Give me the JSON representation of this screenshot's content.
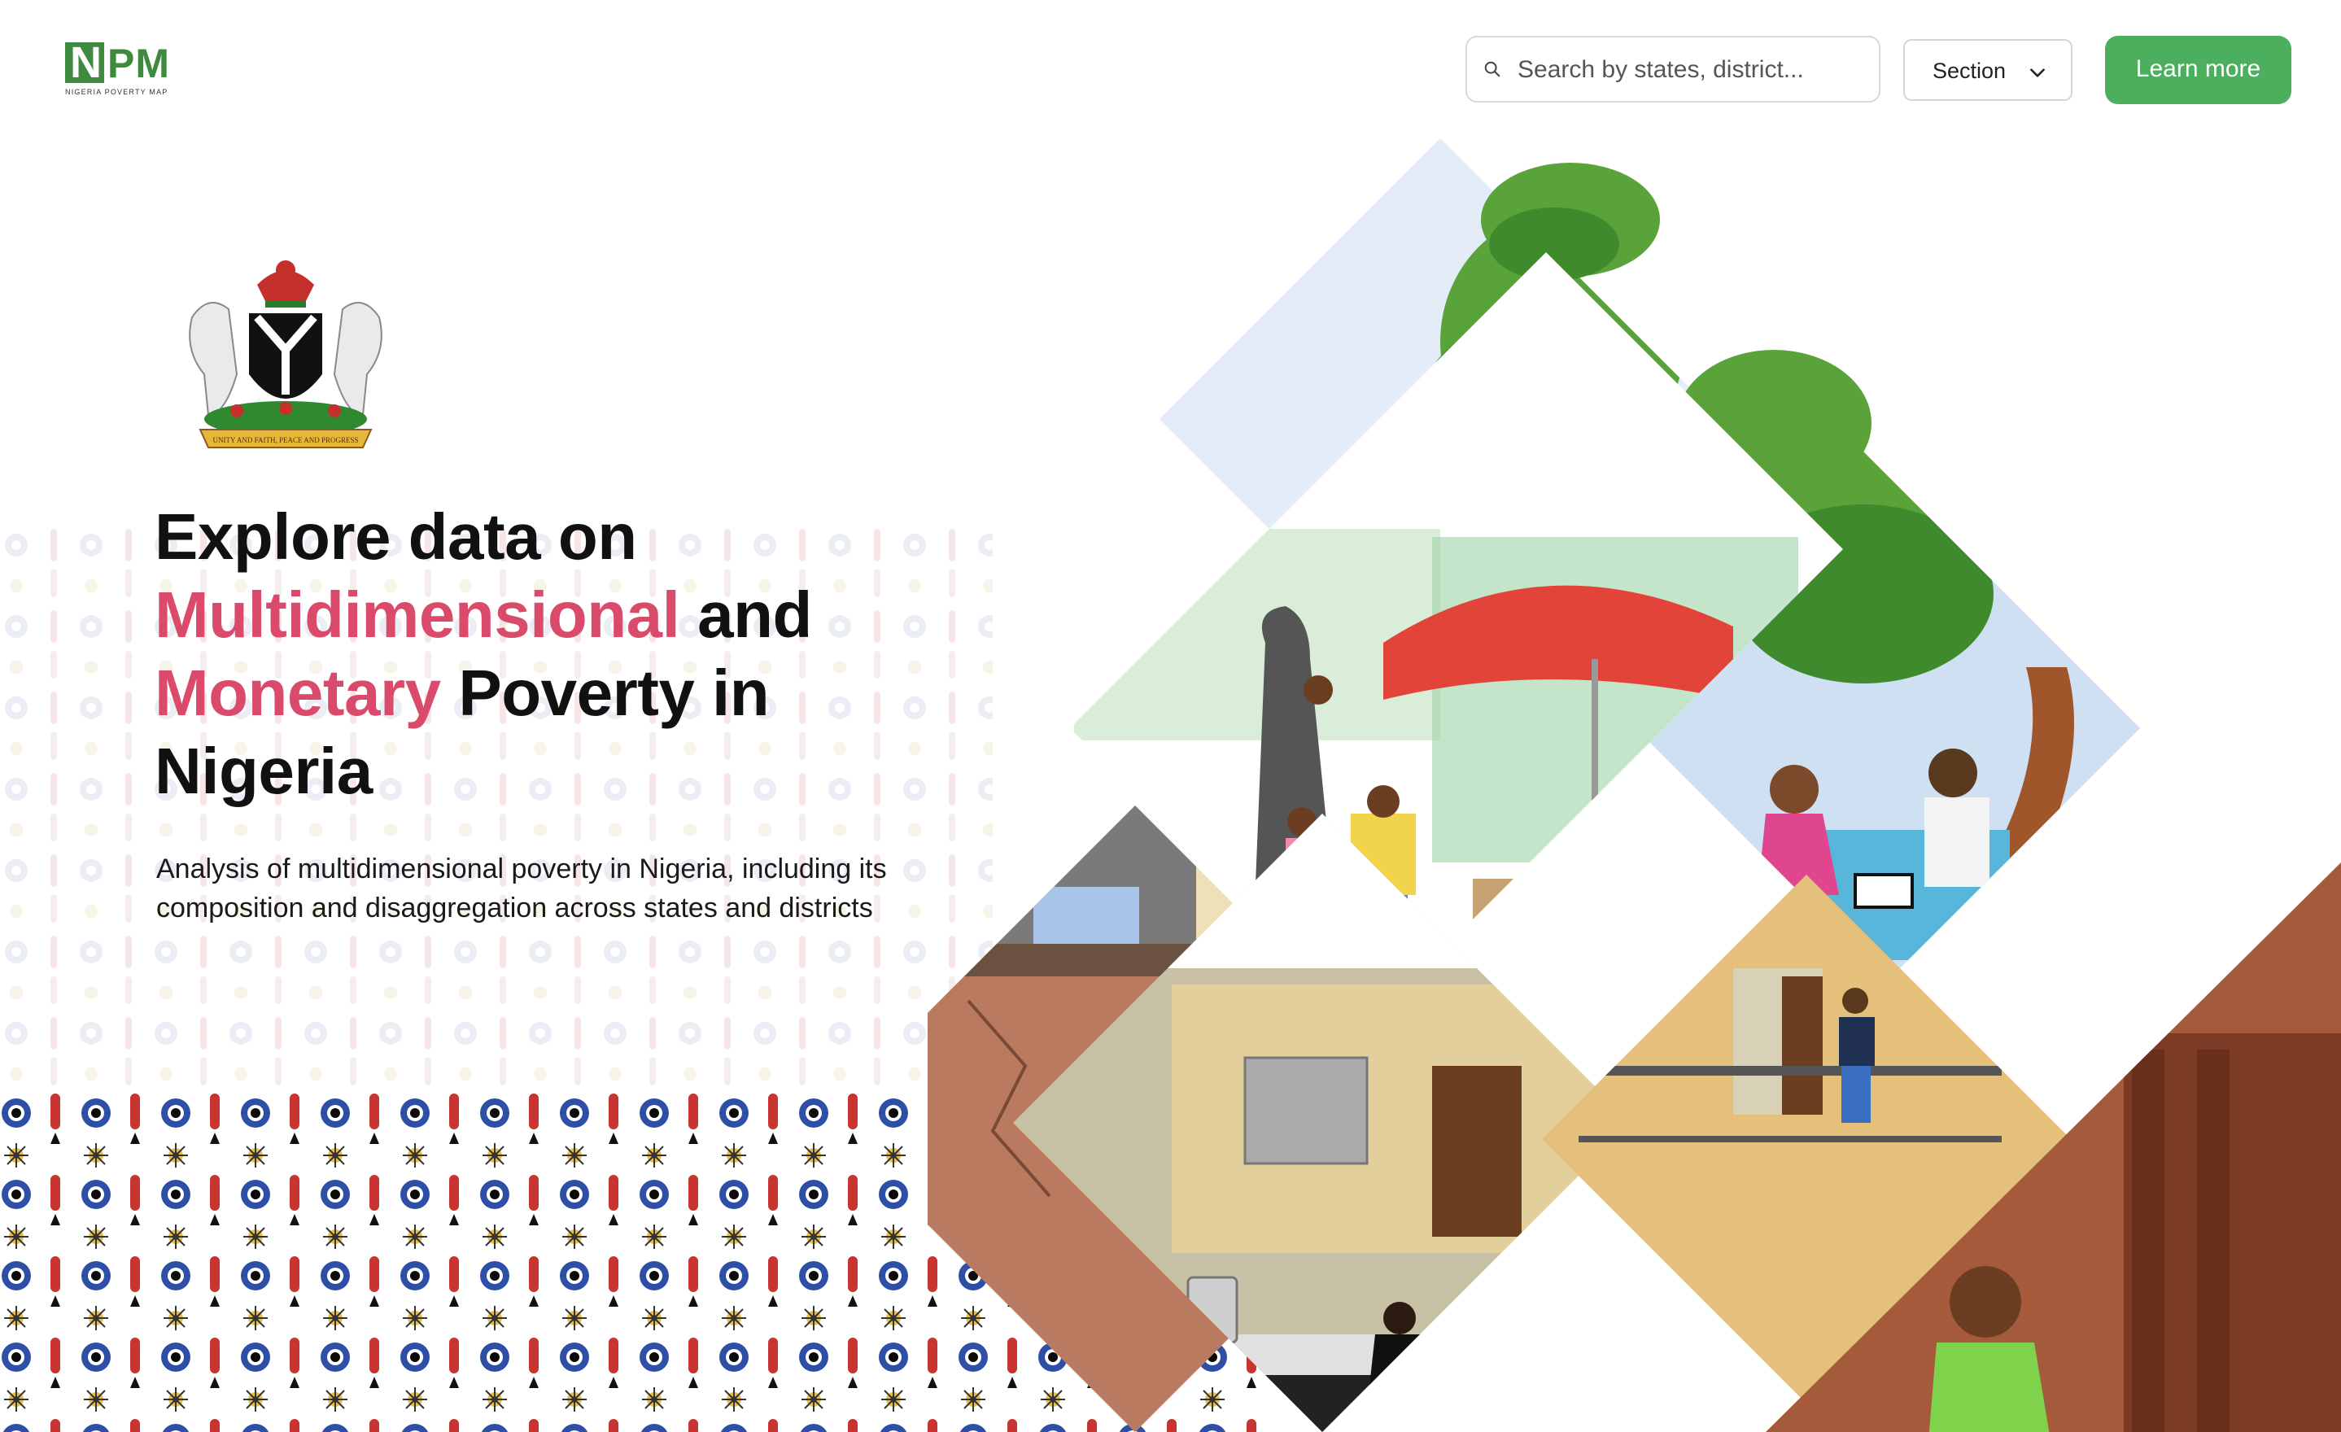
{
  "header": {
    "logo_mark": "N",
    "logo_letters": "PM",
    "logo_subtitle": "NIGERIA POVERTY MAP",
    "search_placeholder": "Search by states, district...",
    "section_label": "Section",
    "learn_more_label": "Learn more"
  },
  "coat_of_arms": {
    "motto": "UNITY AND FAITH, PEACE AND PROGRESS"
  },
  "hero": {
    "line1": "Explore data on",
    "line2_highlight": "Multidimensional",
    "line2_rest": " and",
    "line3_highlight": "Monetary",
    "line3_rest": " Poverty in",
    "line4": "Nigeria",
    "description": "Analysis of multidimensional poverty in Nigeria, including its composition and disaggregation across states and districts"
  },
  "colors": {
    "brand_green": "#3f8a3f",
    "button_green": "#4caf5e",
    "highlight_pink": "#d94a6b"
  }
}
